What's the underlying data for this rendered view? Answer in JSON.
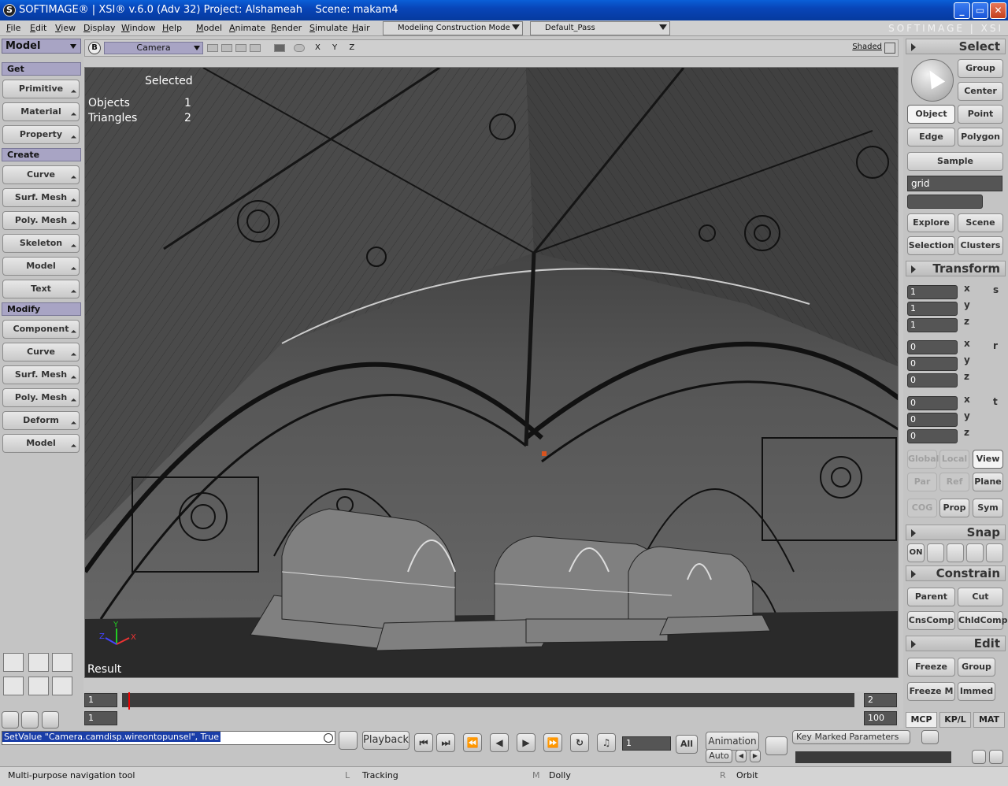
{
  "window": {
    "title": "SOFTIMAGE® | XSI® v.6.0 (Adv 32) Project: Alshameah    Scene: makam4",
    "brand": "SOFTIMAGE | XSI"
  },
  "menu": [
    "File",
    "Edit",
    "View",
    "Display",
    "Window",
    "Help",
    "Model",
    "Animate",
    "Render",
    "Simulate",
    "Hair"
  ],
  "toolbar": {
    "construction_mode": "Modeling Construction Mode",
    "pass": "Default_Pass"
  },
  "left_panel": {
    "mode": "Model",
    "sections": [
      {
        "label": "Get",
        "buttons": [
          "Primitive",
          "Material",
          "Property"
        ]
      },
      {
        "label": "Create",
        "buttons": [
          "Curve",
          "Surf. Mesh",
          "Poly. Mesh",
          "Skeleton",
          "Model",
          "Text"
        ]
      },
      {
        "label": "Modify",
        "buttons": [
          "Component",
          "Curve",
          "Surf. Mesh",
          "Poly. Mesh",
          "Deform",
          "Model"
        ]
      }
    ]
  },
  "viewport": {
    "camera": "Camera",
    "axes_label": "X Y Z",
    "display_mode": "Shaded",
    "hud_selected": "Selected",
    "hud_objects_label": "Objects",
    "hud_objects_value": "1",
    "hud_triangles_label": "Triangles",
    "hud_triangles_value": "2",
    "result": "Result"
  },
  "right_panel": {
    "select_title": "Select",
    "group": "Group",
    "center": "Center",
    "object": "Object",
    "point": "Point",
    "edge": "Edge",
    "polygon": "Polygon",
    "sample": "Sample",
    "search_value": "grid",
    "explore": "Explore",
    "scene": "Scene",
    "selection": "Selection",
    "clusters": "Clusters",
    "transform_title": "Transform",
    "scale": [
      "1",
      "1",
      "1"
    ],
    "rotate": [
      "0",
      "0",
      "0"
    ],
    "translate": [
      "0",
      "0",
      "0"
    ],
    "axis_labels": [
      "x",
      "y",
      "z"
    ],
    "srt_labels": [
      "s",
      "r",
      "t"
    ],
    "global": "Global",
    "local": "Local",
    "view": "View",
    "par": "Par",
    "ref": "Ref",
    "plane": "Plane",
    "cog": "COG",
    "prop": "Prop",
    "sym": "Sym",
    "snap_title": "Snap",
    "snap_on": "ON",
    "constrain_title": "Constrain",
    "parent": "Parent",
    "cut": "Cut",
    "cnscomp": "CnsComp",
    "chldcomp": "ChldComp",
    "edit_title": "Edit",
    "freeze": "Freeze",
    "edit_group": "Group",
    "freeze_m": "Freeze M",
    "immed": "Immed",
    "tabs": [
      "MCP",
      "KP/L",
      "MAT"
    ]
  },
  "timeline": {
    "start": "1",
    "current_start": "1",
    "end": "2",
    "end_total": "100"
  },
  "bottom": {
    "command": "SetValue \"Camera.camdisp.wireontopunsel\", True",
    "playback": "Playback",
    "frame": "1",
    "all": "All",
    "animation": "Animation",
    "auto": "Auto",
    "key_marked": "Key Marked Parameters"
  },
  "status": {
    "message": "Multi-purpose navigation tool",
    "l_key": "L",
    "l_label": "Tracking",
    "m_key": "M",
    "m_label": "Dolly",
    "r_key": "R",
    "r_label": "Orbit"
  }
}
